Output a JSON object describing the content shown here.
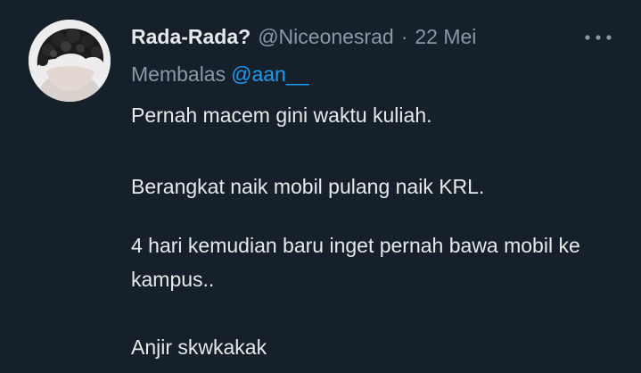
{
  "tweet": {
    "author": {
      "display_name": "Rada-Rada?",
      "handle": "@Niceonesrad",
      "separator": "·",
      "timestamp": "22 Mei",
      "avatar_icon": "profile-photo-curly-hair"
    },
    "more_icon": "more-horizontal-icon",
    "reply": {
      "prefix": "Membalas",
      "mention": "@aan__"
    },
    "paragraphs": [
      "Pernah macem gini waktu kuliah.",
      "Berangkat naik mobil pulang naik KRL.",
      "4 hari kemudian baru inget pernah bawa mobil ke kampus..",
      "Anjir skwkakak"
    ]
  },
  "colors": {
    "background": "#15202b",
    "primary_text": "#e7e9ea",
    "secondary_text": "#8b98a5",
    "link": "#1d9bf0"
  }
}
